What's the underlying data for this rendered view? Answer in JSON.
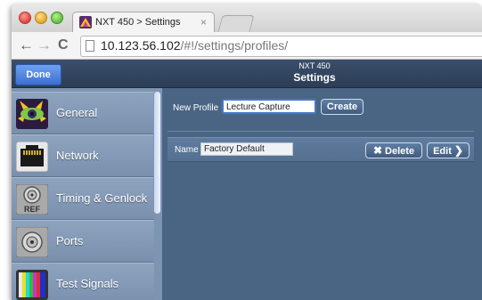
{
  "browser": {
    "tab": {
      "title": "NXT 450 > Settings",
      "close": "×"
    },
    "nav": {
      "back": "←",
      "forward": "→",
      "reload": "C"
    },
    "address": {
      "host": "10.123.56.102",
      "path": "/#!/settings/profiles/"
    }
  },
  "app": {
    "done_label": "Done",
    "device_name": "NXT 450",
    "page_title": "Settings"
  },
  "sidebar": {
    "items": [
      {
        "label": "General",
        "icon": "eye-icon"
      },
      {
        "label": "Network",
        "icon": "ethernet-port-icon"
      },
      {
        "label": "Timing & Genlock",
        "icon": "bnc-ref-icon",
        "icon_text": "REF"
      },
      {
        "label": "Ports",
        "icon": "bnc-port-icon"
      },
      {
        "label": "Test Signals",
        "icon": "color-bars-icon"
      }
    ]
  },
  "profiles": {
    "new_profile_label": "New Profile",
    "new_profile_value": "Lecture Capture",
    "create_label": "Create",
    "rows": [
      {
        "name_label": "Name",
        "name_value": "Factory Default",
        "delete_label": "Delete",
        "edit_label": "Edit"
      }
    ]
  },
  "colors": {
    "accent": "#3b6fd1",
    "content_bg": "#4a6584",
    "sidebar_bg": "#7e95b2",
    "topbar_bg": "#2c3d55"
  }
}
